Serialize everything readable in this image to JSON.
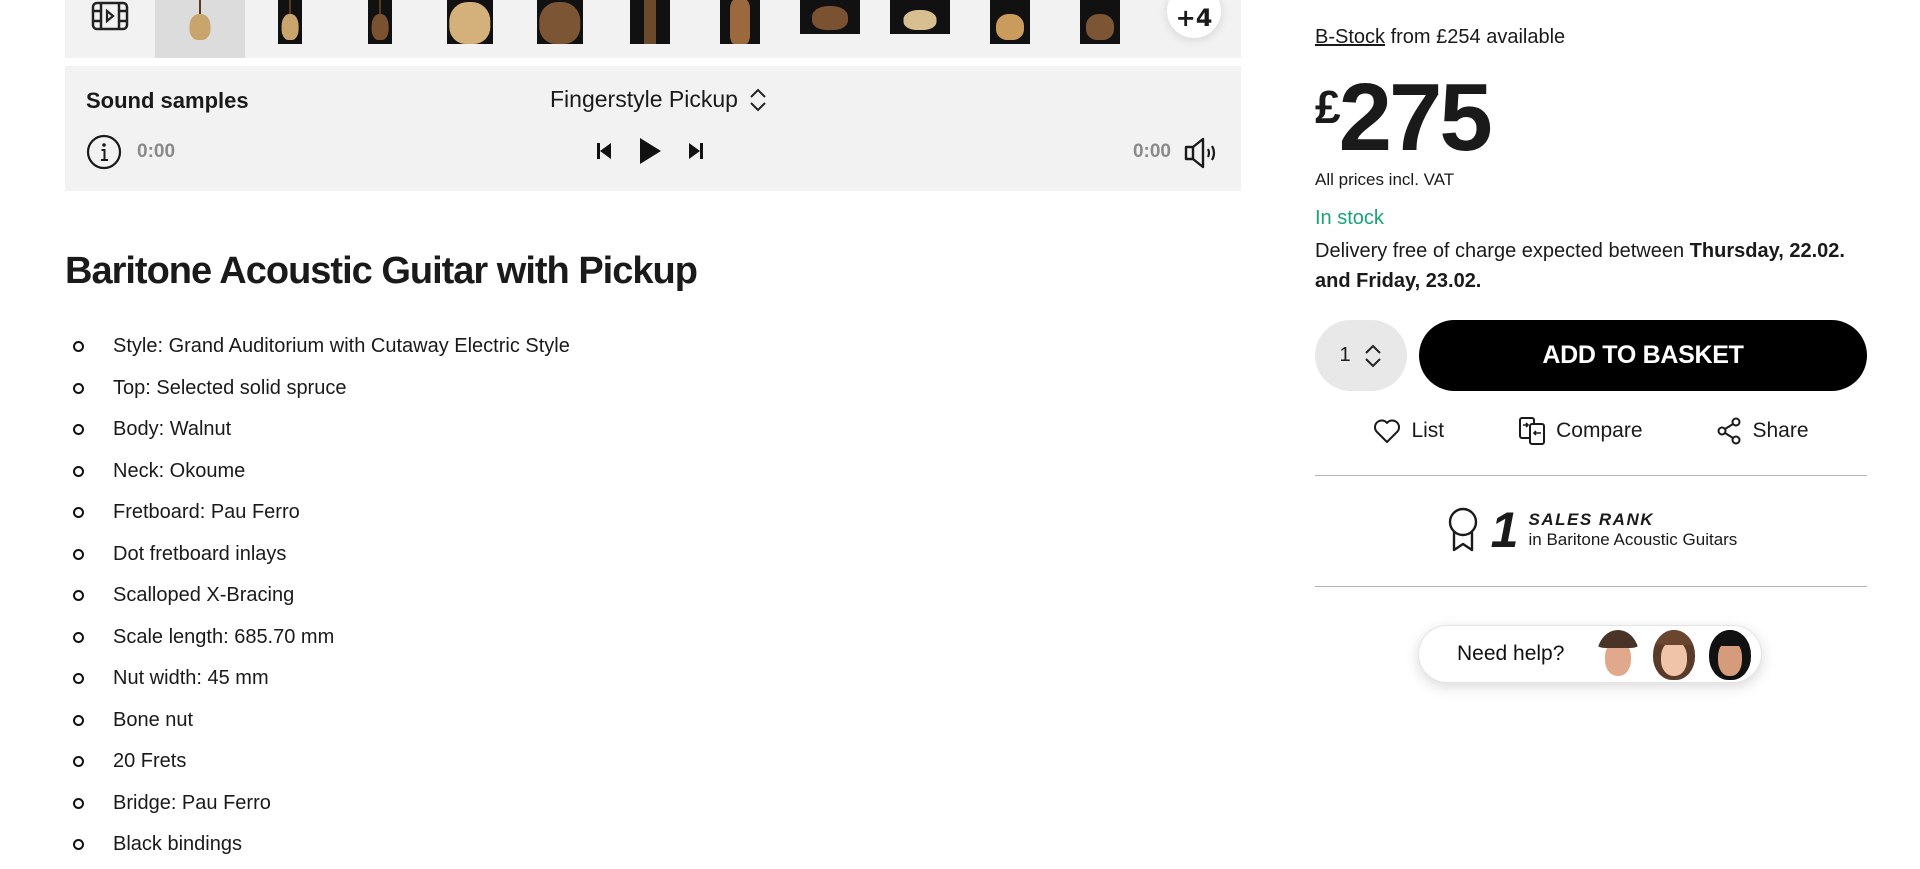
{
  "gallery": {
    "video_icon": "film-play-icon",
    "thumbnails": [
      {
        "label": "Front view natural",
        "active": true
      },
      {
        "label": "Front view dark background",
        "active": false
      },
      {
        "label": "Back view walnut",
        "active": false
      },
      {
        "label": "Body top close-up",
        "active": false
      },
      {
        "label": "Back close-up",
        "active": false
      },
      {
        "label": "Headstock front",
        "active": false
      },
      {
        "label": "Headstock back",
        "active": false
      },
      {
        "label": "Side angle",
        "active": false
      },
      {
        "label": "Angled front",
        "active": false
      },
      {
        "label": "Side body",
        "active": false
      },
      {
        "label": "Back angle",
        "active": false
      }
    ],
    "more_label": "+4"
  },
  "sound_samples": {
    "title": "Sound samples",
    "selected_sample": "Fingerstyle Pickup",
    "current_time": "0:00",
    "total_time": "0:00",
    "icons": {
      "info": "info-icon",
      "previous": "skip-previous-icon",
      "play": "play-icon",
      "next": "skip-next-icon",
      "volume": "volume-icon",
      "select": "chevron-up-down-icon"
    }
  },
  "product": {
    "title": "Baritone Acoustic Guitar with Pickup",
    "features": [
      "Style: Grand Auditorium with Cutaway Electric Style",
      "Top: Selected solid spruce",
      "Body: Walnut",
      "Neck: Okoume",
      "Fretboard: Pau Ferro",
      "Dot fretboard inlays",
      "Scalloped X-Bracing",
      "Scale length: 685.70 mm",
      "Nut width: 45 mm",
      "Bone nut",
      "20 Frets",
      "Bridge: Pau Ferro",
      "Black bindings"
    ]
  },
  "purchase": {
    "bstock_link": "B-Stock",
    "bstock_text": " from £254 available",
    "price_currency": "£",
    "price_amount": "275",
    "vat_note": "All prices incl. VAT",
    "stock_status": "In stock",
    "stock_color": "#1aa37a",
    "delivery_prefix": "Delivery free of charge expected between ",
    "delivery_dates": "Thursday, 22.02. and Friday, 23.02.",
    "quantity": "1",
    "add_to_basket": "ADD TO BASKET",
    "actions": {
      "list": "List",
      "compare": "Compare",
      "share": "Share"
    },
    "sales_rank": {
      "rank": "1",
      "label": "SALES RANK",
      "category": "in Baritone Acoustic Guitars"
    },
    "help": {
      "label": "Need help?"
    }
  }
}
